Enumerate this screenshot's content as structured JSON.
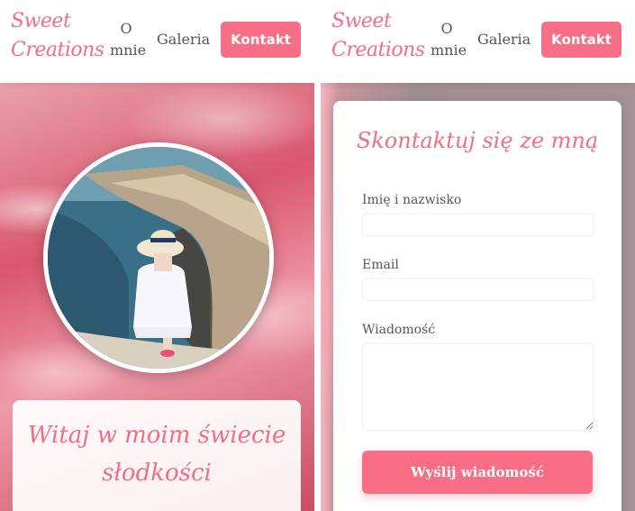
{
  "brand": {
    "line1": "Sweet",
    "line2": "Creations"
  },
  "nav": {
    "about_line1": "O",
    "about_line2": "mnie",
    "gallery": "Galeria",
    "contact": "Kontakt"
  },
  "hero": {
    "title_line1": "Witaj w moim świecie",
    "title_line2": "słodkości"
  },
  "contact_form": {
    "title": "Skontaktuj się ze mną",
    "name_label": "Imię i nazwisko",
    "name_value": "",
    "email_label": "Email",
    "email_value": "",
    "message_label": "Wiadomość",
    "message_value": "",
    "submit_label": "Wyślij wiadomość"
  },
  "colors": {
    "accent": "#f86e85",
    "brand_text": "#ef6f86"
  }
}
